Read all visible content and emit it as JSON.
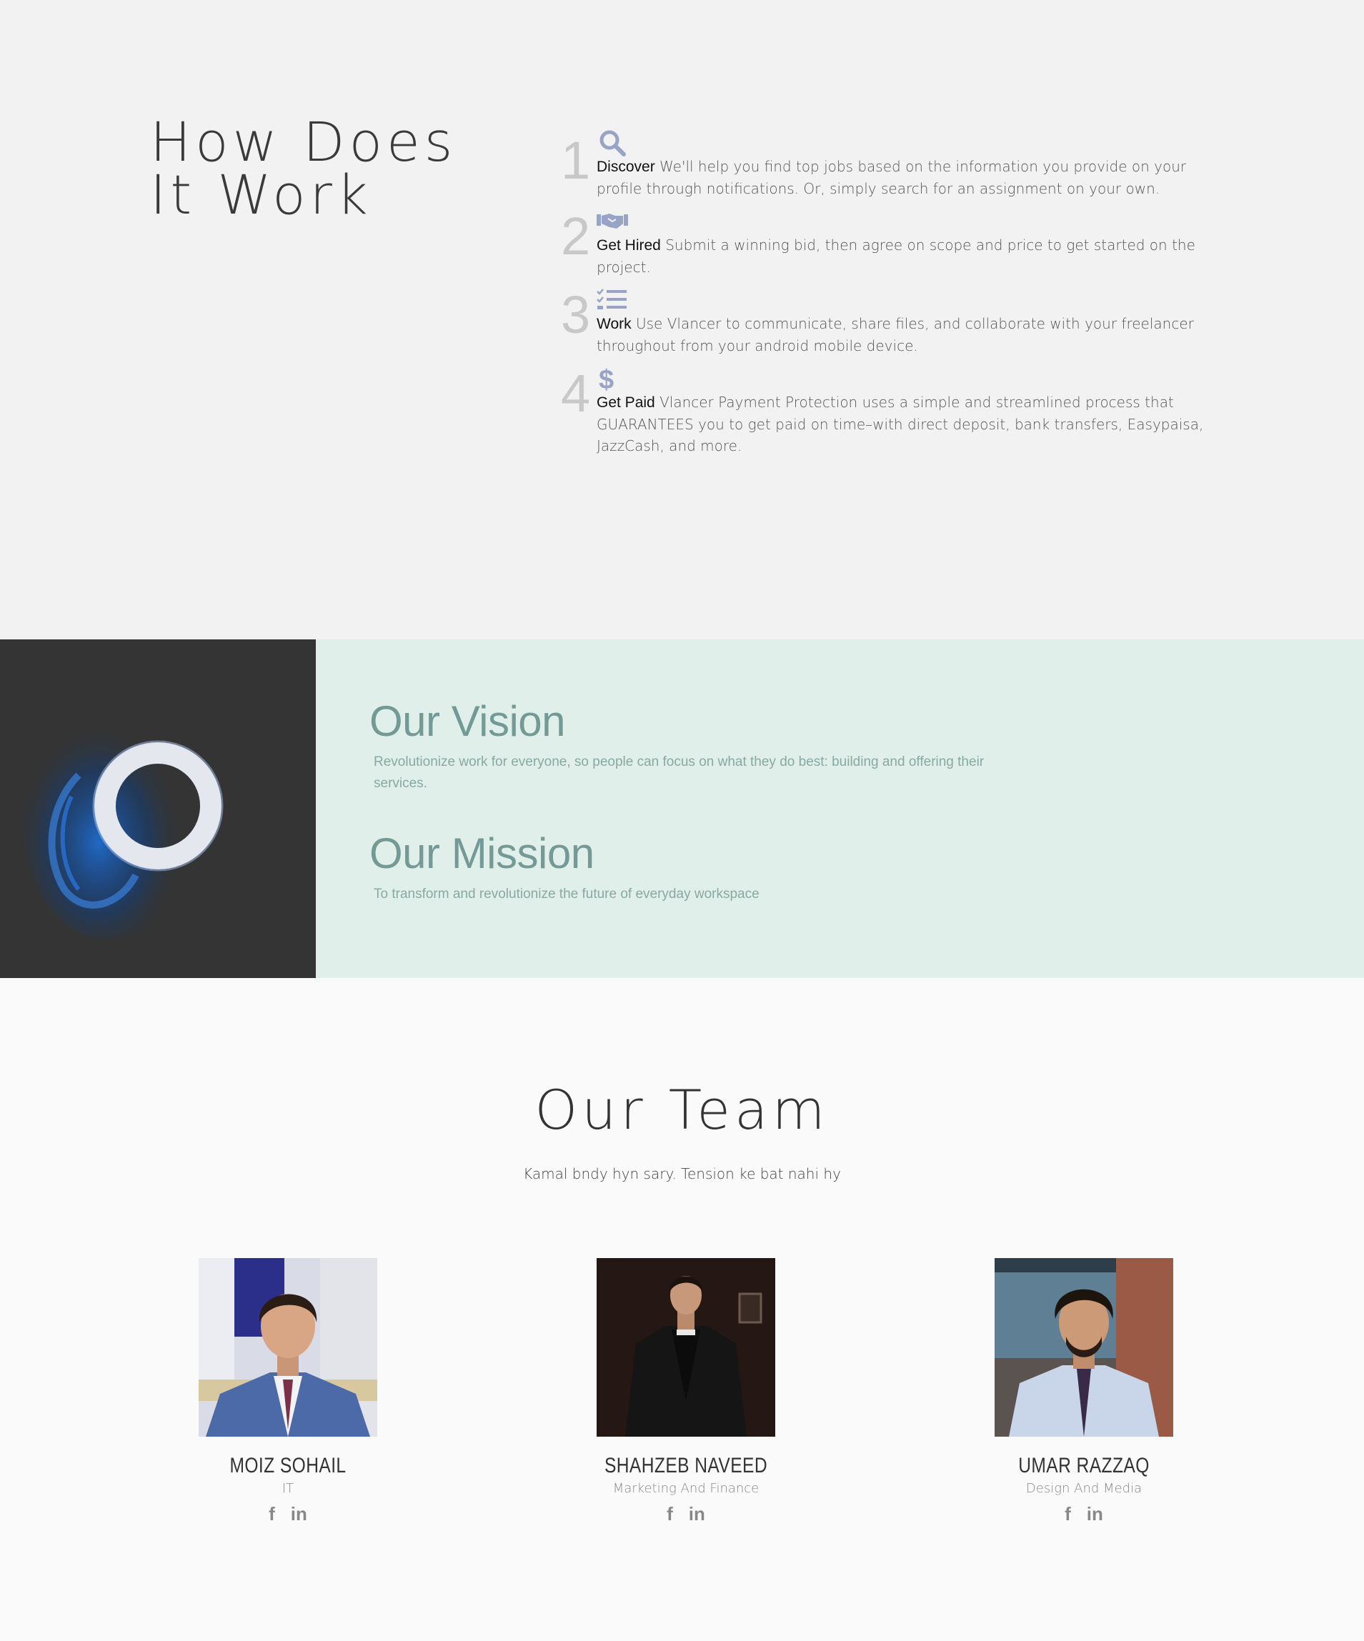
{
  "how": {
    "title_line1": "How Does",
    "title_line2": "It Work",
    "steps": [
      {
        "num": "1",
        "icon": "search-icon",
        "title": "Discover",
        "text": " We'll help you find top jobs based on the information you provide on your profile through notifications. Or, simply search for an assignment on your own."
      },
      {
        "num": "2",
        "icon": "handshake-icon",
        "title": "Get Hired",
        "text": " Submit a winning bid, then agree on scope and price to get started on the project."
      },
      {
        "num": "3",
        "icon": "tasks-icon",
        "title": "Work",
        "text": " Use Vlancer to communicate, share files, and collaborate with your freelancer throughout from your android mobile device."
      },
      {
        "num": "4",
        "icon": "dollar-icon",
        "title": "Get Paid",
        "text": " Vlancer Payment Protection uses a simple and streamlined process that GUARANTEES you to get paid on time–with direct deposit, bank transfers, Easypaisa, JazzCash, and more."
      }
    ],
    "icon_color": "#98a4c6"
  },
  "vision": {
    "title": "Our Vision",
    "text": "Revolutionize work for everyone, so people can focus on what they do best: building and offering their services."
  },
  "mission": {
    "title": "Our Mission",
    "text": "To transform and revolutionize the future of everyday workspace"
  },
  "team": {
    "title": "Our Team",
    "subtitle": "Kamal bndy hyn sary. Tension ke bat nahi hy",
    "members": [
      {
        "name": "MOIZ SOHAIL",
        "role": "IT"
      },
      {
        "name": "SHAHZEB NAVEED",
        "role": "Marketing And Finance"
      },
      {
        "name": "UMAR RAZZAQ",
        "role": "Design And Media"
      }
    ],
    "social": {
      "facebook": "f",
      "linkedin": "in"
    }
  },
  "colors": {
    "how_bg": "#f1f2f1",
    "vm_bg": "#e0efe9",
    "vm_heading": "#739a95",
    "vm_text": "#88a9a2",
    "team_bg": "#fafafa"
  }
}
